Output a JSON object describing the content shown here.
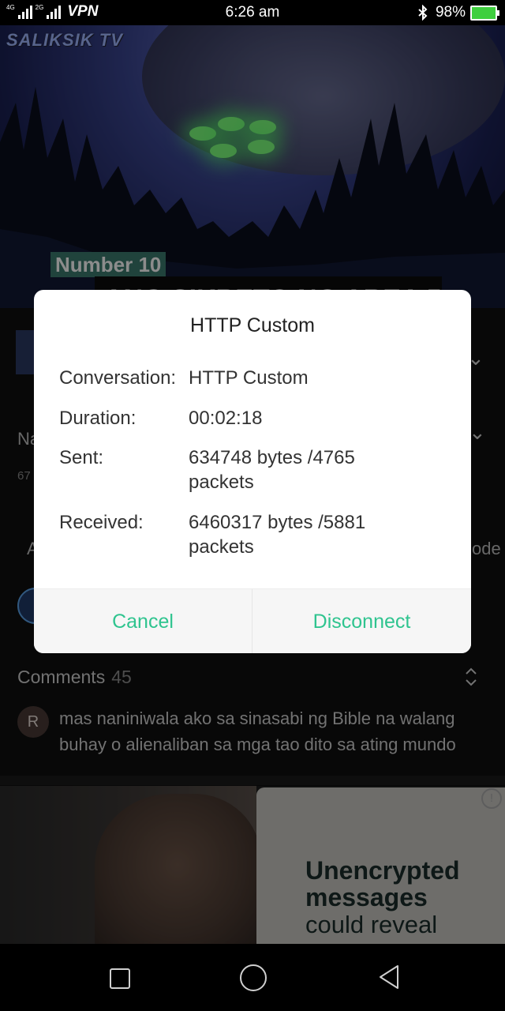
{
  "status_bar": {
    "net_top": "4G",
    "net_bottom": "2G",
    "vpn": "VPN",
    "time": "6:26 am",
    "battery": "98%"
  },
  "video": {
    "brand": "SALIKSIK TV",
    "badge": "Number 10",
    "headline": "ANG SIKRETO NG AREA 51"
  },
  "background": {
    "title_fragment": "Na",
    "views_fragment": "67",
    "action_fragment": "A",
    "mode_fragment": "ode"
  },
  "comments": {
    "label": "Comments",
    "count": "45",
    "items": [
      {
        "avatar_letter": "R",
        "text": "mas naniniwala ako sa sinasabi ng Bible na walang buhay o alienaliban sa mga tao dito sa ating mundo"
      }
    ]
  },
  "ad": {
    "headline": "Unencrypted messages",
    "sub": "could reveal"
  },
  "dialog": {
    "title": "HTTP Custom",
    "rows": [
      {
        "label": "Conversation:",
        "value": "HTTP Custom"
      },
      {
        "label": "Duration:",
        "value": "00:02:18"
      },
      {
        "label": "Sent:",
        "value": "634748 bytes /4765 packets"
      },
      {
        "label": "Received:",
        "value": "6460317 bytes /5881 packets"
      }
    ],
    "cancel": "Cancel",
    "disconnect": "Disconnect"
  },
  "colors": {
    "accent": "#2fc48f",
    "battery": "#3ecf3e"
  },
  "icons": [
    "signal-icon",
    "bluetooth-icon",
    "battery-icon",
    "chevron-down-icon",
    "sort-icon",
    "info-icon",
    "recents-icon",
    "home-icon",
    "back-icon"
  ]
}
